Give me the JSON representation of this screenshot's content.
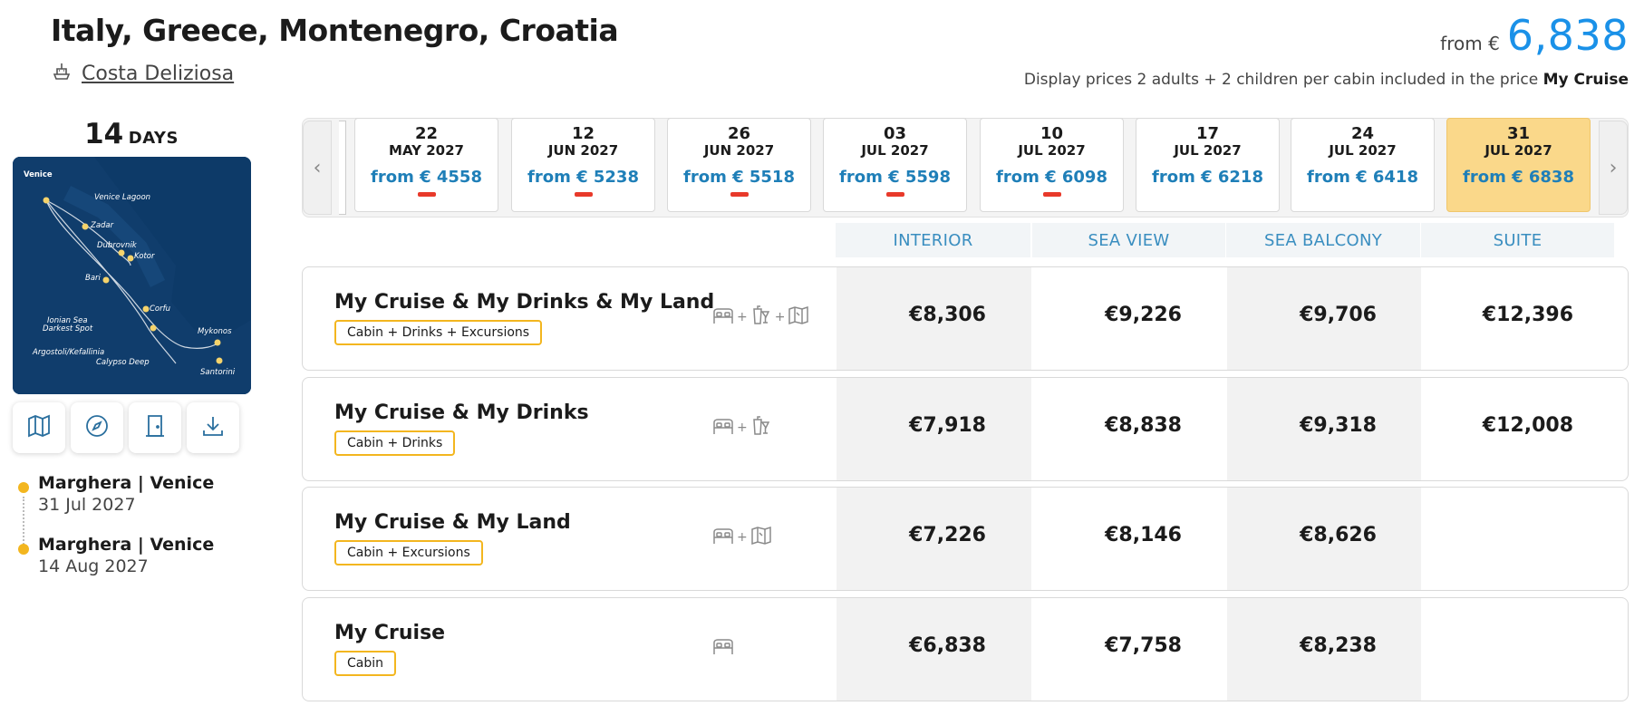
{
  "header": {
    "title": "Italy, Greece, Montenegro, Croatia",
    "ship_name": "Costa Deliziosa",
    "from_label": "from €",
    "from_amount": "6,838",
    "display_note": "Display prices 2 adults + 2 children per cabin included in the price",
    "display_note_package": "My Cruise"
  },
  "itinerary": {
    "days_number": "14",
    "days_label": "DAYS",
    "map_labels": [
      "Venice",
      "Venice Lagoon",
      "Zadar",
      "Dubrovnik",
      "Kotor",
      "Bari",
      "Corfu",
      "Ionian Sea",
      "Darkest Spot",
      "Mykonos",
      "Argostoli/Kefallinia",
      "Calypso Deep",
      "Santorini"
    ],
    "tools": [
      "map-icon",
      "compass-icon",
      "door-icon",
      "download-icon"
    ],
    "stops": [
      {
        "place": "Marghera | Venice",
        "date": "31 Jul 2027"
      },
      {
        "place": "Marghera | Venice",
        "date": "14 Aug 2027"
      }
    ]
  },
  "carousel": {
    "prev_symbol": "‹",
    "next_symbol": "›",
    "dates": [
      {
        "day": "22",
        "month_year": "MAY 2027",
        "price": "from € 4558",
        "red_bar": true,
        "selected": false
      },
      {
        "day": "12",
        "month_year": "JUN 2027",
        "price": "from € 5238",
        "red_bar": true,
        "selected": false
      },
      {
        "day": "26",
        "month_year": "JUN 2027",
        "price": "from € 5518",
        "red_bar": true,
        "selected": false
      },
      {
        "day": "03",
        "month_year": "JUL 2027",
        "price": "from € 5598",
        "red_bar": true,
        "selected": false
      },
      {
        "day": "10",
        "month_year": "JUL 2027",
        "price": "from € 6098",
        "red_bar": true,
        "selected": false
      },
      {
        "day": "17",
        "month_year": "JUL 2027",
        "price": "from € 6218",
        "red_bar": false,
        "selected": false
      },
      {
        "day": "24",
        "month_year": "JUL 2027",
        "price": "from € 6418",
        "red_bar": false,
        "selected": false
      },
      {
        "day": "31",
        "month_year": "JUL 2027",
        "price": "from € 6838",
        "red_bar": false,
        "selected": true
      }
    ]
  },
  "cabins": [
    "INTERIOR",
    "SEA VIEW",
    "SEA BALCONY",
    "SUITE"
  ],
  "packages": [
    {
      "name": "My Cruise & My Drinks & My Land",
      "badge": "Cabin + Drinks + Excursions",
      "icons": [
        "bed-icon",
        "drinks-icon",
        "map-icon"
      ],
      "prices": [
        "€8,306",
        "€9,226",
        "€9,706",
        "€12,396"
      ]
    },
    {
      "name": "My Cruise & My Drinks",
      "badge": "Cabin + Drinks",
      "icons": [
        "bed-icon",
        "drinks-icon"
      ],
      "prices": [
        "€7,918",
        "€8,838",
        "€9,318",
        "€12,008"
      ]
    },
    {
      "name": "My Cruise & My Land",
      "badge": "Cabin + Excursions",
      "icons": [
        "bed-icon",
        "map-icon"
      ],
      "prices": [
        "€7,226",
        "€8,146",
        "€8,626",
        ""
      ]
    },
    {
      "name": "My Cruise",
      "badge": "Cabin",
      "icons": [
        "bed-icon"
      ],
      "prices": [
        "€6,838",
        "€7,758",
        "€8,238",
        ""
      ]
    }
  ],
  "colors": {
    "accent_blue": "#1a91e8",
    "date_price_blue": "#1f7fb8",
    "selected_date_bg": "#fad88a",
    "badge_border": "#f3b61f",
    "red_bar": "#e8392a",
    "cabin_header_text": "#3a8ec0"
  }
}
